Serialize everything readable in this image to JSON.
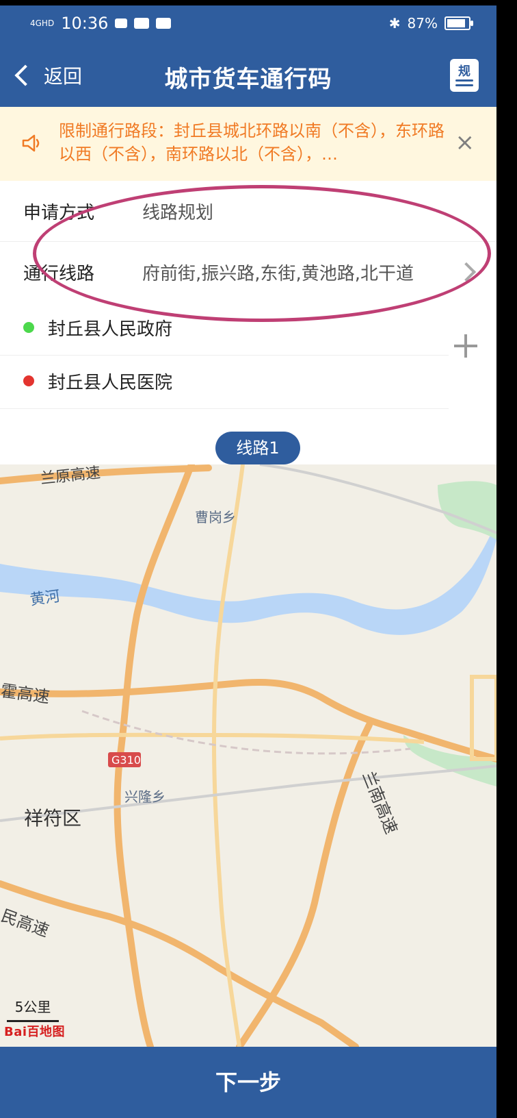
{
  "status_bar": {
    "network": "4GHD",
    "time": "10:36",
    "battery": "87%"
  },
  "nav": {
    "back_label": "返回",
    "title": "城市货车通行码",
    "rule_icon_label": "规"
  },
  "notice": {
    "text": "限制通行路段：封丘县城北环路以南（不含），东环路以西（不含），南环路以北（不含），…",
    "close": "×"
  },
  "form": {
    "apply_method_label": "申请方式",
    "apply_method_value": "线路规划",
    "route_label": "通行线路",
    "route_value": "府前街,振兴路,东街,黄池路,北干道"
  },
  "stops": [
    {
      "name": "封丘县人民政府",
      "color": "#4cd84c"
    },
    {
      "name": "封丘县人民医院",
      "color": "#e3342f"
    }
  ],
  "route_tab": "线路1",
  "map": {
    "labels": {
      "lanyuan": "兰原高速",
      "caogang": "曹岗乡",
      "yellow_river": "黄河",
      "lianhuo": "霍高速",
      "g310": "G310",
      "xinglong": "兴隆乡",
      "xiangfu": "祥符区",
      "lannan": "兰南高速",
      "minhigh": "民高速"
    },
    "scale": "5公里",
    "logo": "Bai百地图"
  },
  "bottom_button": "下一步"
}
